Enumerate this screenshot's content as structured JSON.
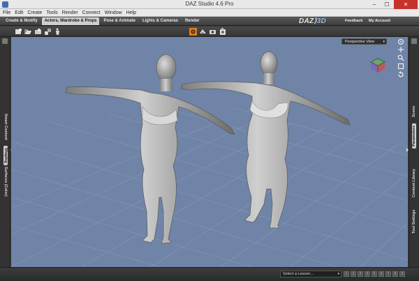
{
  "window": {
    "title": "DAZ Studio 4.6 Pro",
    "minimize": "–",
    "maximize": "☐",
    "close": "✕"
  },
  "menu": [
    "File",
    "Edit",
    "Create",
    "Tools",
    "Render",
    "Connect",
    "Window",
    "Help"
  ],
  "rooms": [
    "Create & Modify",
    "Actors, Wardrobe & Props",
    "Pose & Animate",
    "Lights & Cameras",
    "Render"
  ],
  "active_room": "Actors, Wardrobe & Props",
  "brand": {
    "logo_main": "DAZ",
    "logo_sub": "3D",
    "feedback": "Feedback",
    "account": "My Account"
  },
  "left_panel": {
    "tabs": [
      "Smart Content",
      "Shaping",
      "Surfaces (Color)"
    ],
    "selected": "Shaping"
  },
  "right_panel": {
    "tabs": [
      "Scene",
      "Parameters",
      "Content Library",
      "Tool Settings"
    ],
    "selected": "Parameters"
  },
  "viewport": {
    "view_name": "Perspective View",
    "dropdown": "▾",
    "background": "#6f84a7"
  },
  "bottom": {
    "lesson_placeholder": "Select a Lesson...",
    "dropdown": "▾",
    "steps": [
      "1",
      "2",
      "3",
      "4",
      "5",
      "6",
      "7",
      "8",
      "9"
    ]
  },
  "icons": {
    "toolbar": [
      "new-scene-icon",
      "open-icon",
      "save-icon",
      "merge-icon",
      "figure-icon",
      "render-settings-icon",
      "render-icon",
      "camera-icon",
      "render-album-icon"
    ],
    "nav": [
      "orbit-icon",
      "pan-icon",
      "zoom-icon",
      "frame-icon",
      "reset-view-icon"
    ]
  },
  "colors": {
    "accent_tab": "#cfcfcf",
    "close_button": "#c7312b",
    "viewport_bg": "#6f84a7",
    "render_icon": "#e07a1a"
  }
}
